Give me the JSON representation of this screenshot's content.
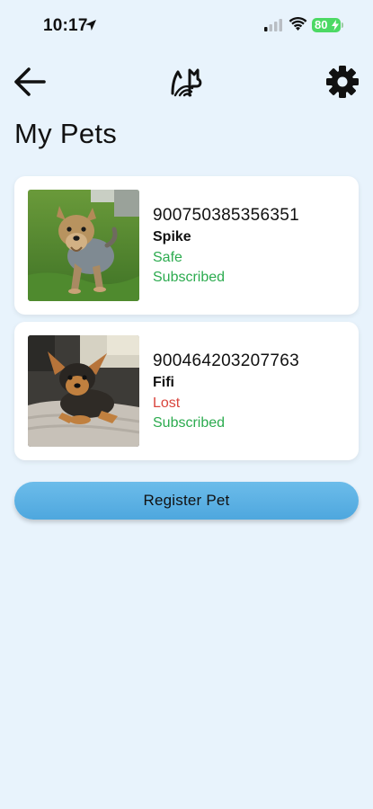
{
  "status_bar": {
    "time": "10:17",
    "battery": "80",
    "icons": [
      "location-arrow-icon",
      "cellular-signal-icon",
      "wifi-icon",
      "battery-icon"
    ]
  },
  "header": {
    "back_icon": "arrow-left-icon",
    "logo_icon": "app-logo-icon",
    "settings_icon": "gear-icon"
  },
  "page": {
    "title": "My Pets"
  },
  "pets": [
    {
      "id": "900750385356351",
      "name": "Spike",
      "status": "Safe",
      "status_color": "#2cab4f",
      "subscription": "Subscribed"
    },
    {
      "id": "900464203207763",
      "name": "Fifi",
      "status": "Lost",
      "status_color": "#d9453d",
      "subscription": "Subscribed"
    }
  ],
  "actions": {
    "register_label": "Register Pet"
  },
  "colors": {
    "background": "#e8f3fc",
    "accent": "#55aadf",
    "safe": "#2cab4f",
    "lost": "#d9453d",
    "battery": "#4cd964"
  }
}
